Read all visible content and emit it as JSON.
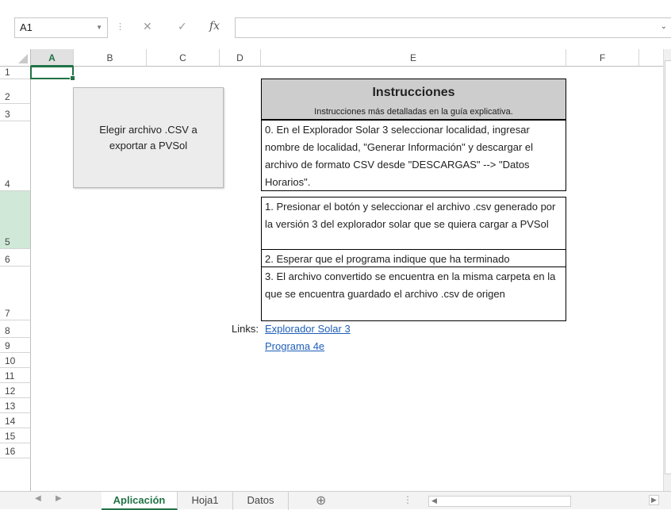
{
  "formula_bar": {
    "name_box": "A1",
    "cancel_icon": "✕",
    "enter_icon": "✓",
    "fx_icon": "fx",
    "formula": ""
  },
  "columns": [
    "A",
    "B",
    "C",
    "D",
    "E",
    "F"
  ],
  "selected_column": "A",
  "rows": [
    "1",
    "2",
    "3",
    "4",
    "5",
    "6",
    "7",
    "8",
    "9",
    "10",
    "11",
    "12",
    "13",
    "14",
    "15",
    "16"
  ],
  "highlighted_row": "5",
  "button": {
    "label": "Elegir archivo .CSV a\nexportar a PVSol"
  },
  "instructions": {
    "title": "Instrucciones",
    "subtitle": "Instrucciones más detalladas en la guía explicativa.",
    "steps": [
      "0. En el Explorador Solar 3 seleccionar localidad, ingresar nombre de localidad, \"Generar Información\" y descargar el archivo de formato CSV desde \"DESCARGAS\" --> \"Datos Horarios\".",
      "1. Presionar el botón y seleccionar el archivo .csv generado por la versión 3 del explorador solar que se quiera cargar a PVSol",
      "2. Esperar que el programa indique que ha terminado",
      "3. El archivo convertido se encuentra en la misma carpeta en la que se encuentra guardado el archivo .csv de origen"
    ]
  },
  "links": {
    "label": "Links:",
    "items": [
      "Explorador Solar 3",
      "Programa 4e"
    ]
  },
  "sheet_tabs": {
    "tabs": [
      "Aplicación",
      "Hoja1",
      "Datos"
    ],
    "active": "Aplicación",
    "add_icon": "⊕"
  },
  "colors": {
    "accent": "#217346",
    "link": "#1f5fb8",
    "header_fill": "#cdcdcd",
    "button_fill": "#ececec"
  }
}
